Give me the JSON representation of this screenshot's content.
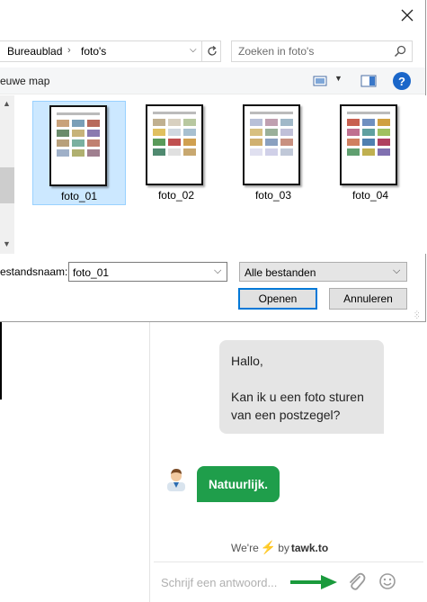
{
  "dialog": {
    "breadcrumb": [
      "Bureaublad",
      "foto's"
    ],
    "search_placeholder": "Zoeken in foto's",
    "new_folder": "euwe map",
    "files": [
      {
        "name": "foto_01",
        "selected": true
      },
      {
        "name": "foto_02",
        "selected": false
      },
      {
        "name": "foto_03",
        "selected": false
      },
      {
        "name": "foto_04",
        "selected": false
      }
    ],
    "filename_label": "estandsnaam:",
    "filename_value": "foto_01",
    "filetype": "Alle bestanden",
    "open_label": "Openen",
    "cancel_label": "Annuleren",
    "colors": {
      "selection": "#cce8ff",
      "accent": "#0078d7"
    }
  },
  "chat": {
    "visitor_line1": "Hallo,",
    "visitor_line2": "Kan ik u een foto sturen van een postzegel?",
    "agent_message": "Natuurlijk.",
    "branding_prefix": "We're",
    "branding_by": "by",
    "branding_name": "tawk.to",
    "input_placeholder": "Schrijf een antwoord...",
    "colors": {
      "agent_bubble": "#1f9e4b",
      "visitor_bubble": "#e5e5e5",
      "arrow": "#1a9a3c"
    }
  }
}
